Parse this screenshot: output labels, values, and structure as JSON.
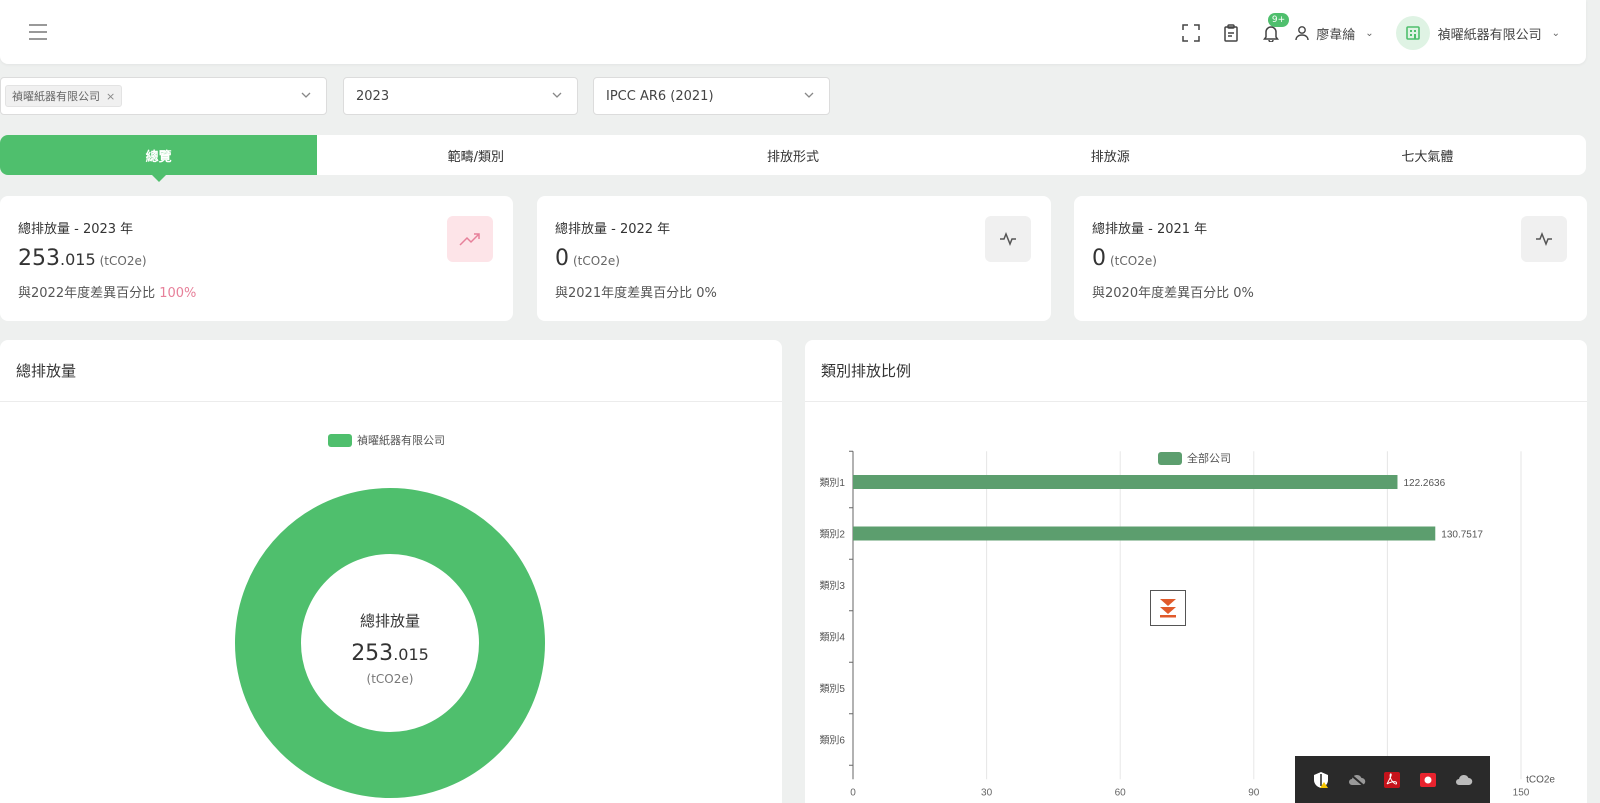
{
  "header": {
    "notification_badge": "9+",
    "user_name": "廖韋綸",
    "company_name": "禎曜紙器有限公司"
  },
  "filters": {
    "company_tag": "禎曜紙器有限公司",
    "year": "2023",
    "standard": "IPCC AR6 (2021)"
  },
  "tabs": [
    {
      "label": "總覽",
      "active": true
    },
    {
      "label": "範疇/類別",
      "active": false
    },
    {
      "label": "排放形式",
      "active": false
    },
    {
      "label": "排放源",
      "active": false
    },
    {
      "label": "七大氣體",
      "active": false
    }
  ],
  "cards": [
    {
      "title": "總排放量 - 2023 年",
      "value_int": "253",
      "value_dec": ".015",
      "unit": "(tCO2e)",
      "diff_label": "與2022年度差異百分比",
      "diff_pct": "100%",
      "icon": "trend-up-icon"
    },
    {
      "title": "總排放量 - 2022 年",
      "value_int": "0",
      "value_dec": "",
      "unit": "(tCO2e)",
      "diff_label": "與2021年度差異百分比",
      "diff_pct": "0%",
      "icon": "pulse-icon"
    },
    {
      "title": "總排放量 - 2021 年",
      "value_int": "0",
      "value_dec": "",
      "unit": "(tCO2e)",
      "diff_label": "與2020年度差異百分比",
      "diff_pct": "0%",
      "icon": "pulse-icon"
    }
  ],
  "donut_panel": {
    "title": "總排放量",
    "legend": "禎曜紙器有限公司",
    "center_title": "總排放量",
    "center_value_int": "253",
    "center_value_dec": ".015",
    "center_unit": "(tCO2e)",
    "color": "#4fbf6d"
  },
  "bar_panel": {
    "title": "類別排放比例"
  },
  "chart_data": {
    "type": "bar",
    "orientation": "horizontal",
    "categories": [
      "類別1",
      "類別2",
      "類別3",
      "類別4",
      "類別5",
      "類別6"
    ],
    "series": [
      {
        "name": "全部公司",
        "values": [
          122.2636,
          130.7517,
          0,
          0,
          0,
          0
        ]
      }
    ],
    "data_labels": [
      "122.2636",
      "130.7517"
    ],
    "x_ticks": [
      "0",
      "30",
      "60",
      "90",
      "120",
      "150"
    ],
    "xlim": [
      0,
      150
    ],
    "xlabel": "tCO2e",
    "grid": true,
    "legend_position": "top",
    "color": "#5c9e6e"
  },
  "colors": {
    "accent": "#4fbf6d",
    "danger_text": "#e7809a",
    "danger_bg": "#fde4e8"
  }
}
